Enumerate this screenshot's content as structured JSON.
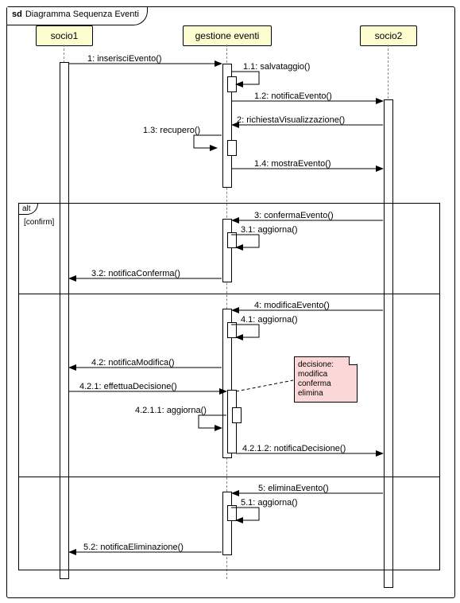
{
  "frame": {
    "kind": "sd",
    "title": "Diagramma Sequenza Eventi"
  },
  "lifelines": {
    "l1": "socio1",
    "l2": "gestione eventi",
    "l3": "socio2"
  },
  "messages": {
    "m1": "1: inserisciEvento()",
    "m11": "1.1: salvataggio()",
    "m12": "1.2: notificaEvento()",
    "m2": "2: richiestaVisualizzazione()",
    "m13": "1.3: recupero()",
    "m14": "1.4: mostraEvento()",
    "m3": "3: confermaEvento()",
    "m31": "3.1: aggiorna()",
    "m32": "3.2: notificaConferma()",
    "m4": "4: modificaEvento()",
    "m41": "4.1: aggiorna()",
    "m42": "4.2: notificaModifica()",
    "m421": "4.2.1: effettuaDecisione()",
    "m4211": "4.2.1.1: aggiorna()",
    "m4212": "4.2.1.2: notificaDecisione()",
    "m5": "5: eliminaEvento()",
    "m51": "5.1: aggiorna()",
    "m52": "5.2: notificaEliminazione()"
  },
  "alt": {
    "label": "alt",
    "guard": "[confirm]"
  },
  "note": {
    "l1": "decisione:",
    "l2": "modifica",
    "l3": "conferma",
    "l4": "elimina"
  },
  "chart_data": {
    "type": "uml-sequence",
    "frame": "sd Diagramma Sequenza Eventi",
    "lifelines": [
      "socio1",
      "gestione eventi",
      "socio2"
    ],
    "messages": [
      {
        "id": "1",
        "from": "socio1",
        "to": "gestione eventi",
        "label": "inserisciEvento()",
        "kind": "call"
      },
      {
        "id": "1.1",
        "from": "gestione eventi",
        "to": "gestione eventi",
        "label": "salvataggio()",
        "kind": "self"
      },
      {
        "id": "1.2",
        "from": "gestione eventi",
        "to": "socio2",
        "label": "notificaEvento()",
        "kind": "call"
      },
      {
        "id": "2",
        "from": "socio2",
        "to": "gestione eventi",
        "label": "richiestaVisualizzazione()",
        "kind": "call"
      },
      {
        "id": "1.3",
        "from": "gestione eventi",
        "to": "gestione eventi",
        "label": "recupero()",
        "kind": "self"
      },
      {
        "id": "1.4",
        "from": "gestione eventi",
        "to": "socio2",
        "label": "mostraEvento()",
        "kind": "call"
      }
    ],
    "combinedFragment": {
      "type": "alt",
      "operands": [
        {
          "guard": "confirm",
          "messages": [
            {
              "id": "3",
              "from": "socio2",
              "to": "gestione eventi",
              "label": "confermaEvento()",
              "kind": "call"
            },
            {
              "id": "3.1",
              "from": "gestione eventi",
              "to": "gestione eventi",
              "label": "aggiorna()",
              "kind": "self"
            },
            {
              "id": "3.2",
              "from": "gestione eventi",
              "to": "socio1",
              "label": "notificaConferma()",
              "kind": "call"
            }
          ]
        },
        {
          "guard": "",
          "messages": [
            {
              "id": "4",
              "from": "socio2",
              "to": "gestione eventi",
              "label": "modificaEvento()",
              "kind": "call"
            },
            {
              "id": "4.1",
              "from": "gestione eventi",
              "to": "gestione eventi",
              "label": "aggiorna()",
              "kind": "self"
            },
            {
              "id": "4.2",
              "from": "gestione eventi",
              "to": "socio1",
              "label": "notificaModifica()",
              "kind": "call"
            },
            {
              "id": "4.2.1",
              "from": "socio1",
              "to": "gestione eventi",
              "label": "effettuaDecisione()",
              "kind": "call",
              "note": "decisione: modifica conferma elimina"
            },
            {
              "id": "4.2.1.1",
              "from": "gestione eventi",
              "to": "gestione eventi",
              "label": "aggiorna()",
              "kind": "self"
            },
            {
              "id": "4.2.1.2",
              "from": "gestione eventi",
              "to": "socio2",
              "label": "notificaDecisione()",
              "kind": "call"
            }
          ]
        },
        {
          "guard": "",
          "messages": [
            {
              "id": "5",
              "from": "socio2",
              "to": "gestione eventi",
              "label": "eliminaEvento()",
              "kind": "call"
            },
            {
              "id": "5.1",
              "from": "gestione eventi",
              "to": "gestione eventi",
              "label": "aggiorna()",
              "kind": "self"
            },
            {
              "id": "5.2",
              "from": "gestione eventi",
              "to": "socio1",
              "label": "notificaEliminazione()",
              "kind": "call"
            }
          ]
        }
      ]
    }
  }
}
